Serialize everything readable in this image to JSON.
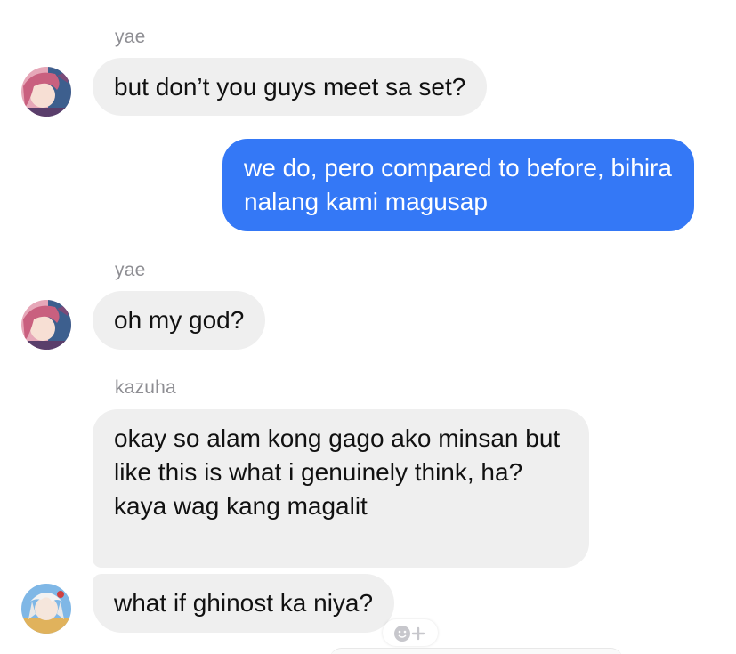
{
  "colors": {
    "incoming_bubble": "#efefef",
    "outgoing_bubble": "#3478f6",
    "sender_name": "#8e8e93"
  },
  "messages": [
    {
      "sender": "yae",
      "direction": "incoming",
      "text": "but don’t you guys meet sa set?"
    },
    {
      "direction": "outgoing",
      "text": "we do, pero compared to before, bihira nalang kami magusap"
    },
    {
      "sender": "yae",
      "direction": "incoming",
      "text": "oh my god?"
    },
    {
      "sender": "kazuha",
      "direction": "incoming",
      "text": "okay so alam kong gago ako minsan but like this is what i genuinely think, ha? kaya wag kang magalit"
    },
    {
      "direction": "incoming",
      "text": "what if ghinost ka niya?"
    }
  ],
  "icons": {
    "avatar_yae": "avatar-pink-hair",
    "avatar_kazuha": "avatar-white-hair",
    "reaction": "add-reaction-icon"
  }
}
